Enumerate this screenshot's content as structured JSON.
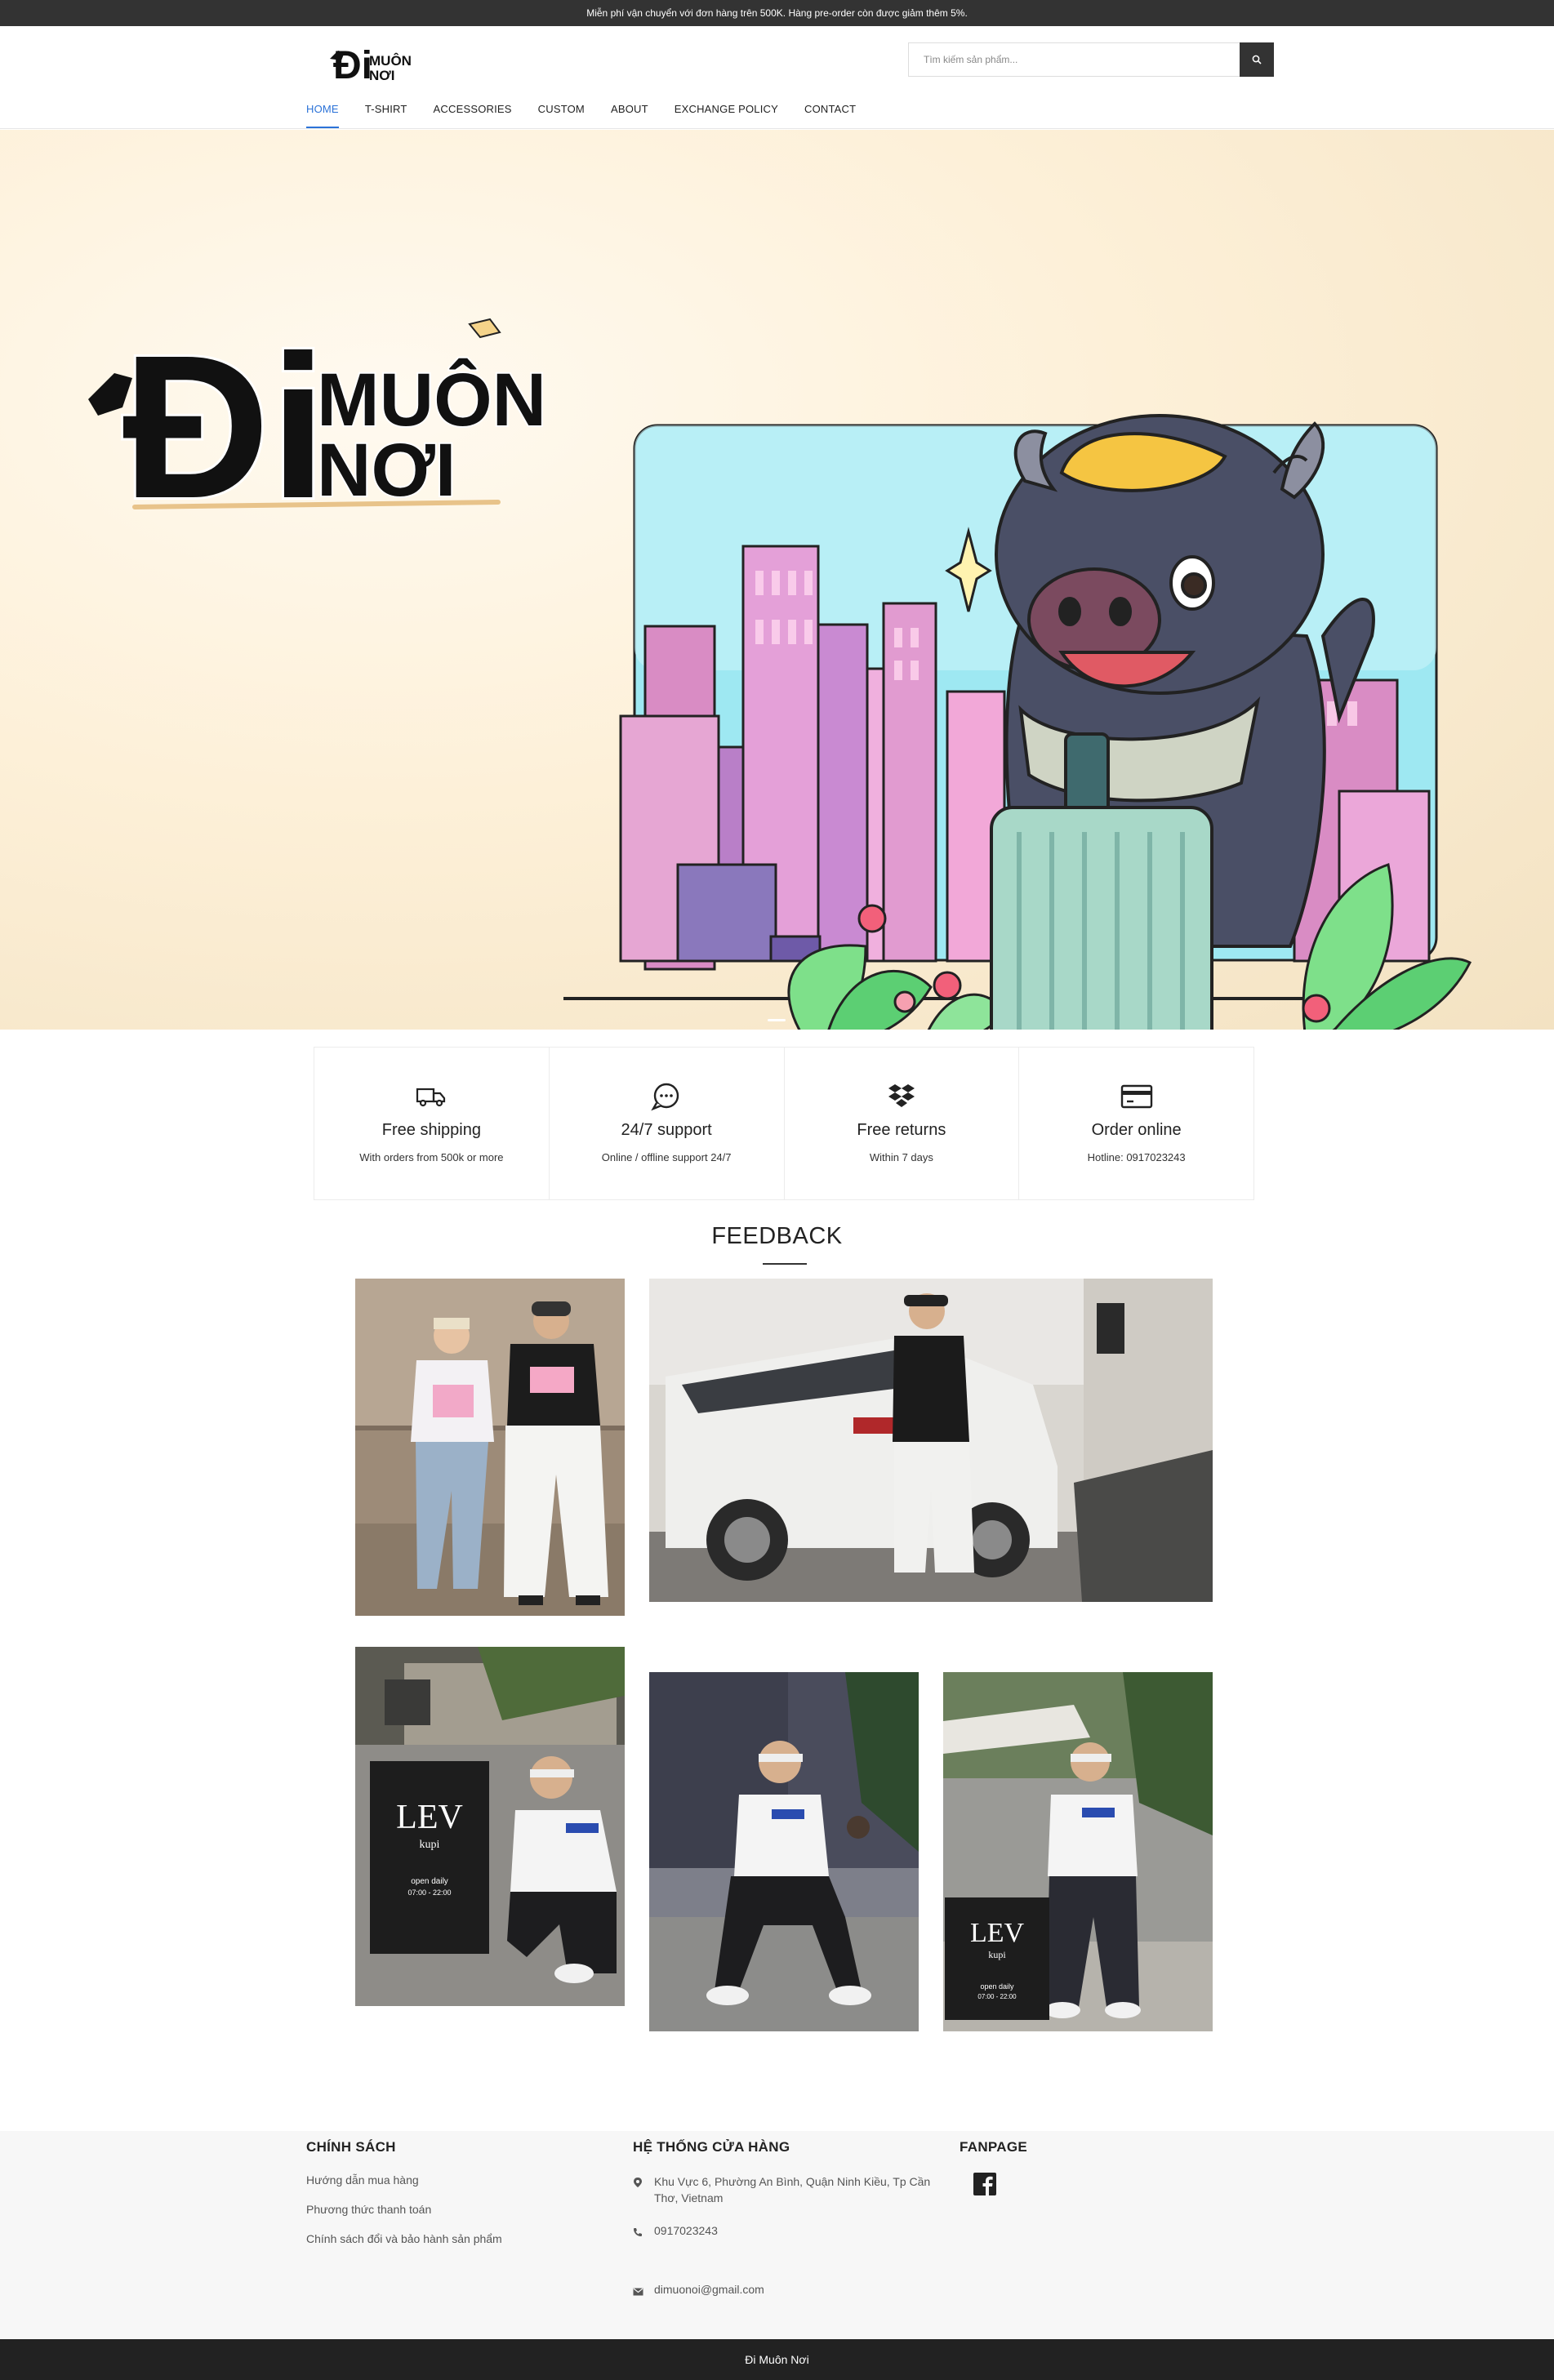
{
  "announcement": "Miễn phí vận chuyển với đơn hàng trên 500K. Hàng pre-order còn được giảm thêm 5%.",
  "brand": {
    "logo_text_main": "Đi",
    "logo_text_top": "MUÔN",
    "logo_text_bottom": "NƠI",
    "logo_icon": "bull-mascot-logo"
  },
  "search": {
    "placeholder": "Tìm kiếm sản phẩm...",
    "icon": "search-icon"
  },
  "nav": [
    {
      "label": "HOME",
      "active": true
    },
    {
      "label": "T-SHIRT"
    },
    {
      "label": "ACCESSORIES"
    },
    {
      "label": "CUSTOM"
    },
    {
      "label": "ABOUT"
    },
    {
      "label": "EXCHANGE POLICY"
    },
    {
      "label": "CONTACT"
    }
  ],
  "hero": {
    "logo_main": "Đi",
    "logo_top": "MUÔN",
    "logo_bottom": "NƠI",
    "illustration": "bull-mascot-with-suitcase-city",
    "colors": {
      "bg": "#fdf0d8",
      "sky": "#9ee8f2",
      "bull": "#4a4f66",
      "helmet": "#f5c542"
    }
  },
  "features": [
    {
      "icon": "truck-icon",
      "title": "Free shipping",
      "subtitle": "With orders from 500k or more"
    },
    {
      "icon": "chat-icon",
      "title": "24/7 support",
      "subtitle": "Online / offline support 24/7"
    },
    {
      "icon": "dropbox-icon",
      "title": "Free returns",
      "subtitle": "Within 7 days"
    },
    {
      "icon": "credit-card-icon",
      "title": "Order online",
      "subtitle": "Hotline: 0917023243"
    }
  ],
  "feedback": {
    "title": "FEEDBACK",
    "photos": [
      {
        "name": "couple-street-photo"
      },
      {
        "name": "car-photo"
      },
      {
        "name": "lev-kupi-sign-photo-1",
        "sign_title": "LEV",
        "sign_sub": "kupi",
        "sign_hours_label": "open daily",
        "sign_hours": "07:00 - 22:00"
      },
      {
        "name": "sitting-chair-photo"
      },
      {
        "name": "lev-kupi-sign-photo-2",
        "sign_title": "LEV",
        "sign_sub": "kupi",
        "sign_hours_label": "open daily",
        "sign_hours": "07:00 - 22:00"
      }
    ]
  },
  "footer": {
    "policy": {
      "title": "CHÍNH SÁCH",
      "links": [
        "Hướng dẫn mua hàng",
        "Phương thức thanh toán",
        "Chính sách đổi và bảo hành sản phẩm"
      ]
    },
    "stores": {
      "title": "HỆ THỐNG CỬA HÀNG",
      "address": "Khu Vực 6, Phường An Bình, Quận Ninh Kiều, Tp Cần Thơ, Vietnam",
      "phone": "0917023243",
      "email": "dimuonoi@gmail.com"
    },
    "fanpage": {
      "title": "FANPAGE",
      "icon": "facebook-icon"
    }
  },
  "copyright": "Đi Muôn Nơi"
}
